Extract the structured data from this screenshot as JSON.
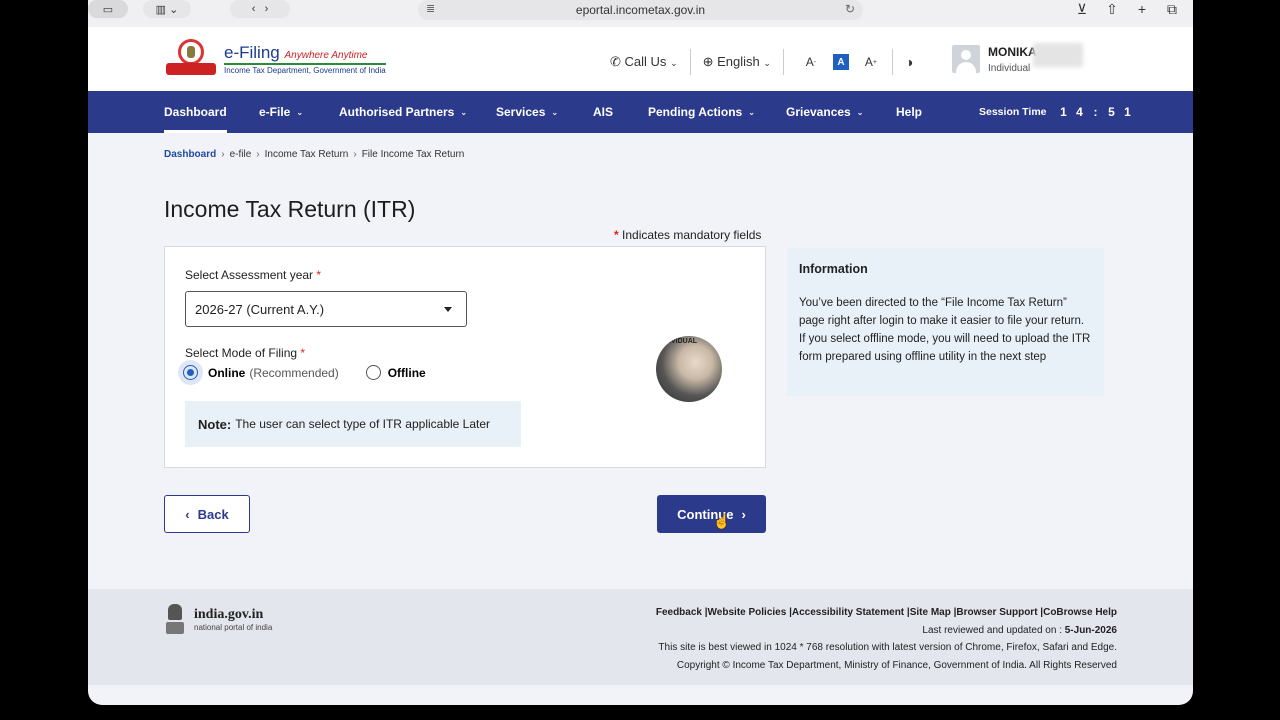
{
  "browser": {
    "url": "eportal.incometax.gov.in"
  },
  "header": {
    "logo_title": "e-Filing",
    "logo_tagline": "Anywhere Anytime",
    "logo_subtitle": "Income Tax Department, Government of India",
    "call_us": "Call Us",
    "language": "English",
    "font_decrease": "A",
    "font_normal": "A",
    "font_increase": "A",
    "user_name": "MONIKA",
    "user_role": "Individual"
  },
  "nav": {
    "items": [
      {
        "label": "Dashboard",
        "active": true,
        "caret": false
      },
      {
        "label": "e-File",
        "caret": true
      },
      {
        "label": "Authorised Partners",
        "caret": true
      },
      {
        "label": "Services",
        "caret": true
      },
      {
        "label": "AIS",
        "caret": false
      },
      {
        "label": "Pending Actions",
        "caret": true
      },
      {
        "label": "Grievances",
        "caret": true
      },
      {
        "label": "Help",
        "caret": false
      }
    ],
    "session_label": "Session Time",
    "session_digits": [
      "1",
      "4",
      ":",
      "5",
      "1"
    ]
  },
  "breadcrumb": [
    "Dashboard",
    "e-file",
    "Income Tax Return",
    "File Income Tax Return"
  ],
  "page": {
    "title": "Income Tax Return (ITR)",
    "mandatory_note": "Indicates mandatory fields"
  },
  "form": {
    "assessment_year_label": "Select Assessment year",
    "assessment_year_value": "2026-27  (Current A.Y.)",
    "mode_label": "Select Mode of Filing",
    "online_label": "Online",
    "online_hint": "(Recommended)",
    "offline_label": "Offline",
    "note_label": "Note:",
    "note_text": "The user can select type of ITR applicable Later",
    "thumb_text": "DIVIDUAL"
  },
  "info": {
    "heading": "Information",
    "para1": "You’ve been directed to the “File Income Tax Return” page right after login to make it easier to file your return.",
    "para2": "If you select offline mode, you will need to upload the ITR form prepared using offline utility in the next step"
  },
  "actions": {
    "back": "Back",
    "continue": "Continue"
  },
  "footer": {
    "portal_name": "india.gov.in",
    "portal_tagline": "national portal of india",
    "links": "Feedback |Website Policies |Accessibility Statement |Site Map |Browser Support |CoBrowse Help",
    "reviewed_label": "Last reviewed and updated on :",
    "reviewed_date": "5-Jun-2026",
    "best_viewed": "This site is best viewed in 1024 * 768 resolution with latest version of Chrome, Firefox, Safari and Edge.",
    "copyright": "Copyright © Income Tax Department, Ministry of Finance, Government of India. All Rights Reserved"
  }
}
